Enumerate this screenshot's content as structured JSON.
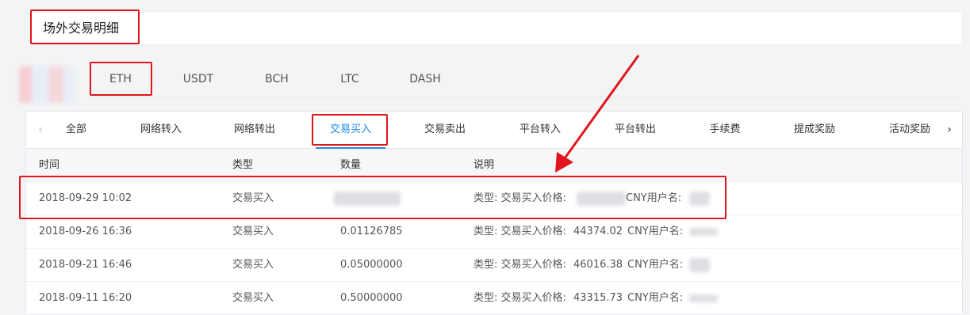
{
  "header": {
    "title": "场外交易明细"
  },
  "coins": [
    {
      "label": "ETH"
    },
    {
      "label": "USDT"
    },
    {
      "label": "BCH"
    },
    {
      "label": "LTC"
    },
    {
      "label": "DASH"
    }
  ],
  "selected_coin": "ETH",
  "type_tabs": [
    {
      "label": "全部"
    },
    {
      "label": "网络转入"
    },
    {
      "label": "网络转出"
    },
    {
      "label": "交易买入"
    },
    {
      "label": "交易卖出"
    },
    {
      "label": "平台转入"
    },
    {
      "label": "平台转出"
    },
    {
      "label": "手续费"
    },
    {
      "label": "提成奖励"
    },
    {
      "label": "活动奖励"
    }
  ],
  "selected_type": "交易买入",
  "nav_icons": {
    "left": "chevron-left-icon",
    "right": "chevron-right-icon"
  },
  "table": {
    "columns": [
      "时间",
      "类型",
      "数量",
      "说明"
    ],
    "rows": [
      {
        "time": "2018-09-29 10:02",
        "type": "交易买入",
        "amount": "",
        "desc_prefix": "类型: 交易买入价格:",
        "price": "",
        "desc_suffix": "CNY用户名:"
      },
      {
        "time": "2018-09-26 16:36",
        "type": "交易买入",
        "amount": "0.01126785",
        "desc_prefix": "类型: 交易买入价格:",
        "price": "44374.02",
        "desc_suffix": "CNY用户名:"
      },
      {
        "time": "2018-09-21 16:46",
        "type": "交易买入",
        "amount": "0.05000000",
        "desc_prefix": "类型: 交易买入价格:",
        "price": "46016.38",
        "desc_suffix": "CNY用户名:"
      },
      {
        "time": "2018-09-11 16:20",
        "type": "交易买入",
        "amount": "0.50000000",
        "desc_prefix": "类型: 交易买入价格:",
        "price": "43315.73",
        "desc_suffix": "CNY用户名:"
      }
    ]
  },
  "colors": {
    "accent": "#1d8ce0",
    "highlight": "#e0151d",
    "background": "#f3f4f6"
  }
}
